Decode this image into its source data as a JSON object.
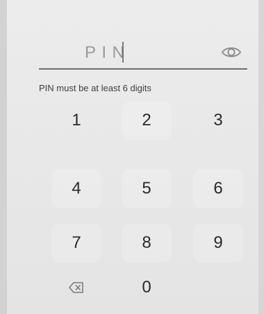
{
  "pin_field": {
    "placeholder": "PIN",
    "visibility_icon": "eye-icon"
  },
  "helper_text": "PIN must be at least 6 digits",
  "keypad": {
    "keys": [
      "1",
      "2",
      "3",
      "4",
      "5",
      "6",
      "7",
      "8",
      "9",
      "0"
    ],
    "backspace_icon": "backspace-icon"
  },
  "colors": {
    "background": "#e8e8e8",
    "text": "#2a2a2a",
    "underline": "#6e6e6e",
    "placeholder": "#9a9a9a"
  }
}
